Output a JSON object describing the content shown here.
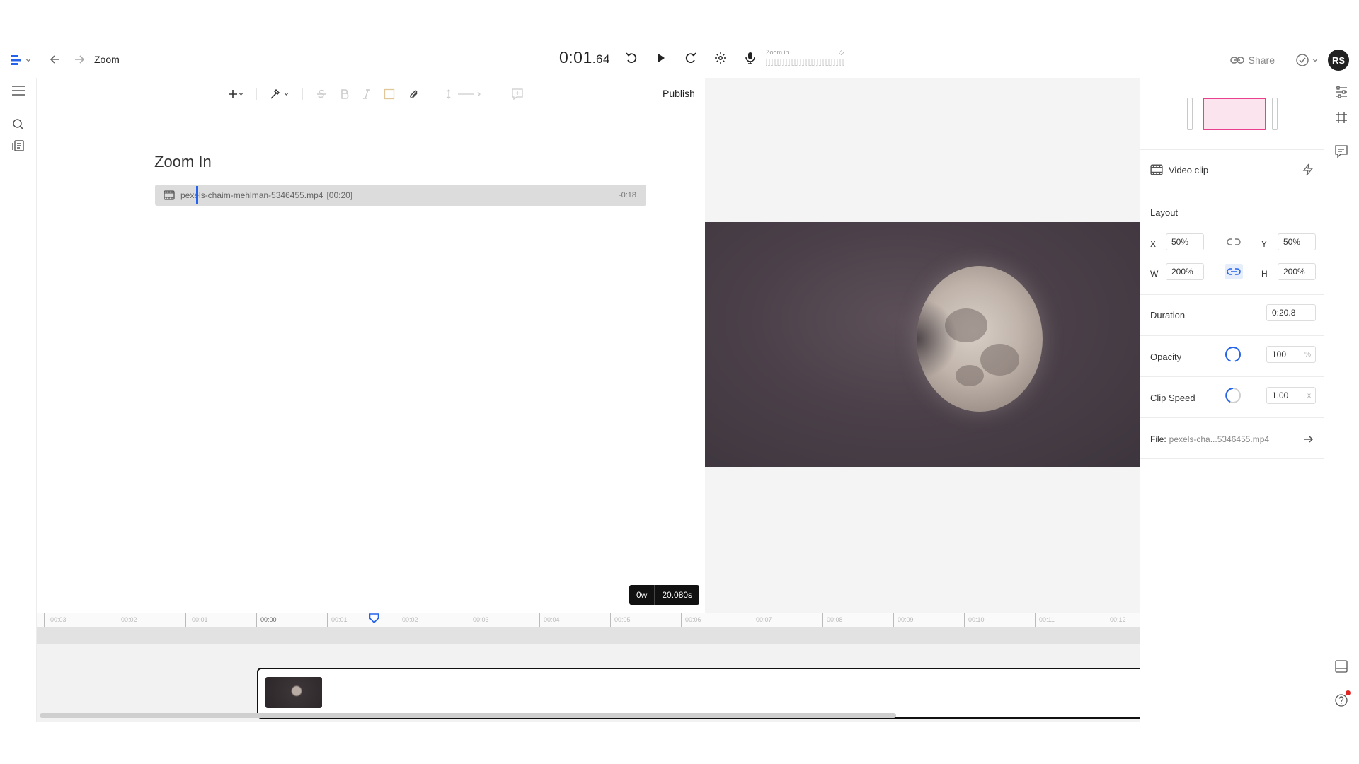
{
  "topbar": {
    "doc_title": "Zoom",
    "timecode_main": "0:01",
    "timecode_frac": ".64",
    "script_label": "Zoom in",
    "share_label": "Share",
    "avatar_initials": "RS"
  },
  "editor": {
    "publish_label": "Publish",
    "title": "Zoom In",
    "clip": {
      "name": "pexels-chaim-mehlman-5346455.mp4",
      "duration_tag": "[00:20]",
      "remaining": "-0:18"
    },
    "duration_pill": {
      "words": "0w",
      "seconds": "20.080s"
    }
  },
  "inspector": {
    "section_title": "Video clip",
    "layout_label": "Layout",
    "x_label": "X",
    "x_value": "50%",
    "y_label": "Y",
    "y_value": "50%",
    "w_label": "W",
    "w_value": "200%",
    "h_label": "H",
    "h_value": "200%",
    "duration_label": "Duration",
    "duration_value": "0:20.8",
    "opacity_label": "Opacity",
    "opacity_value": "100",
    "opacity_unit": "%",
    "speed_label": "Clip Speed",
    "speed_value": "1.00",
    "speed_unit": "x",
    "file_label": "File:",
    "file_value": "pexels-cha...5346455.mp4"
  },
  "timeline": {
    "ticks": [
      "-00:03",
      "-00:02",
      "-00:01",
      "00:00",
      "00:01",
      "00:02",
      "00:03",
      "00:04",
      "00:05",
      "00:06",
      "00:07",
      "00:08",
      "00:09",
      "00:10",
      "00:11",
      "00:12"
    ]
  },
  "colors": {
    "accent": "#2563eb",
    "selection_border": "#e8408f",
    "selection_fill": "#fbe4ee",
    "notification": "#e02424"
  }
}
